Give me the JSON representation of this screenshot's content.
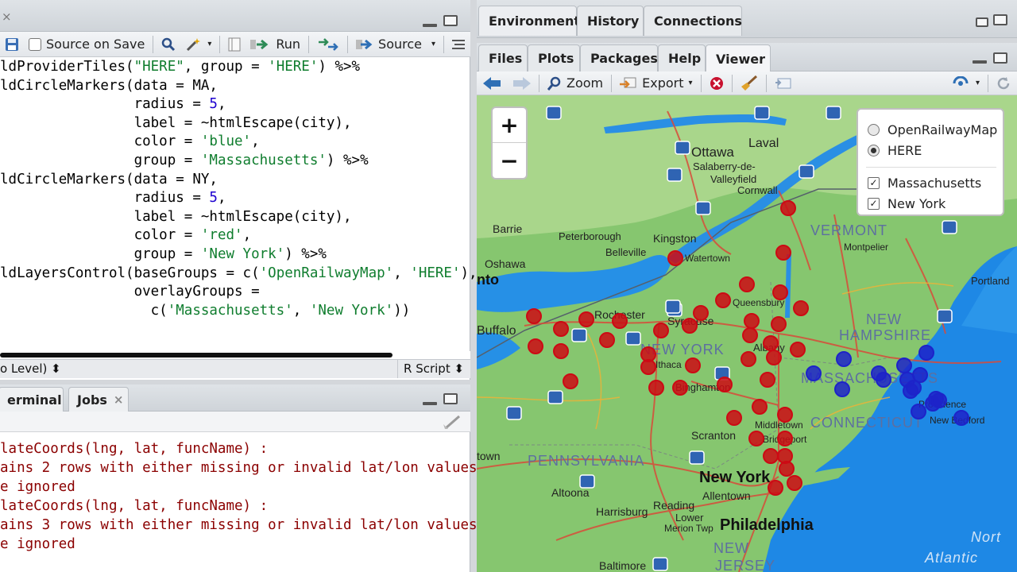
{
  "editor": {
    "toolbar": {
      "source_on_save_label": "Source on Save",
      "run_label": "Run",
      "source_label": "Source"
    },
    "code_lines": [
      [
        "ldProviderTiles(",
        {
          "s": "\"HERE\""
        },
        ", group = ",
        {
          "s": "'HERE'"
        },
        ") %>%"
      ],
      [
        "ldCircleMarkers(data = MA,"
      ],
      [
        "                radius = ",
        {
          "n": "5"
        },
        ","
      ],
      [
        "                label = ~htmlEscape(city),"
      ],
      [
        "                color = ",
        {
          "s": "'blue'"
        },
        ","
      ],
      [
        "                group = ",
        {
          "s": "'Massachusetts'"
        },
        ") %>%"
      ],
      [
        "ldCircleMarkers(data = NY,"
      ],
      [
        "                radius = ",
        {
          "n": "5"
        },
        ","
      ],
      [
        "                label = ~htmlEscape(city),"
      ],
      [
        "                color = ",
        {
          "s": "'red'"
        },
        ","
      ],
      [
        "                group = ",
        {
          "s": "'New York'"
        },
        ") %>%"
      ],
      [
        "ldLayersControl(baseGroups = c(",
        {
          "s": "'OpenRailwayMap'"
        },
        ", ",
        {
          "s": "'HERE'"
        },
        "),"
      ],
      [
        "                overlayGroups ="
      ],
      [
        "                  c(",
        {
          "s": "'Massachusetts'"
        },
        ", ",
        {
          "s": "'New York'"
        },
        "))"
      ]
    ],
    "status_left": "o Level) ⬍",
    "status_right": "R Script ⬍"
  },
  "console": {
    "tabs": [
      "erminal",
      "Jobs"
    ],
    "lines": [
      "lateCoords(lng, lat, funcName) :",
      "ains 2 rows with either missing or invalid lat/lon values",
      "e ignored",
      "lateCoords(lng, lat, funcName) :",
      "ains 3 rows with either missing or invalid lat/lon values",
      "e ignored"
    ]
  },
  "env_pane": {
    "tabs": [
      "Environment",
      "History",
      "Connections"
    ]
  },
  "viewer": {
    "tabs": [
      "Files",
      "Plots",
      "Packages",
      "Help",
      "Viewer"
    ],
    "active_tab": "Viewer",
    "toolbar": {
      "zoom_label": "Zoom",
      "export_label": "Export"
    }
  },
  "map": {
    "zoom_in": "+",
    "zoom_out": "−",
    "layers": {
      "base": [
        {
          "label": "OpenRailwayMap",
          "selected": false
        },
        {
          "label": "HERE",
          "selected": true
        }
      ],
      "overlays": [
        {
          "label": "Massachusetts",
          "checked": true
        },
        {
          "label": "New York",
          "checked": true
        }
      ]
    },
    "labels": {
      "ottawa": "Ottawa",
      "laval": "Laval",
      "salaberry": "Salaberry-de-",
      "valleyfield": "Valleyfield",
      "cornwall": "Cornwall",
      "barrie": "Barrie",
      "peterborough": "Peterborough",
      "kingston": "Kingston",
      "belleville": "Belleville",
      "watertown": "Watertown",
      "oshawa": "Oshawa",
      "nto": "nto",
      "buffalo": "Buffalo",
      "rochester": "Rochester",
      "syracuse": "Syracuse",
      "queensbury": "Queensbury",
      "vermont": "VERMONT",
      "montpelier": "Montpelier",
      "new_hampshire_1": "NEW",
      "new_hampshire_2": "HAMPSHIRE",
      "portland": "Portland",
      "new_york_state": "NEW YORK",
      "ithaca": "Ithaca",
      "binghamton": "Binghamton",
      "albany": "Albany",
      "massachusetts": "MASSACHUSETTS",
      "connecticut": "CONNECTICUT",
      "providence": "Providence",
      "new_bedford": "New Bedford",
      "scranton": "Scranton",
      "middletown": "Middletown",
      "bridgeport": "Bridgeport",
      "pennsylvania": "PENNSYLVANIA",
      "town": "town",
      "new_york_city": "New York",
      "allentown": "Allentown",
      "altoona": "Altoona",
      "reading": "Reading",
      "harrisburg": "Harrisburg",
      "lower_merion": "Lower",
      "merion_twp": "Merion Twp",
      "philadelphia": "Philadelphia",
      "new_jersey_1": "NEW",
      "new_jersey_2": "JERSEY",
      "baltimore": "Baltimore",
      "north_atlantic_1": "Nort",
      "north_atlantic_2": "Atlantic"
    },
    "marker_colors": {
      "ny": "#cc0a14",
      "ma": "#1d23c9"
    },
    "ny_marker_count": 42,
    "ma_marker_count": 16
  }
}
